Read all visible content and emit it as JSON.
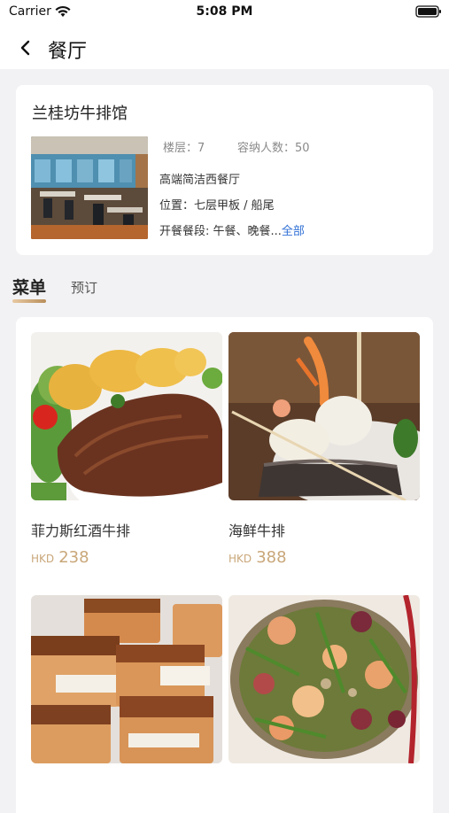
{
  "status_bar": {
    "carrier": "Carrier",
    "time": "5:08 PM"
  },
  "nav": {
    "title": "餐厅"
  },
  "restaurant": {
    "name": "兰桂坊牛排馆",
    "floor_label": "楼层：",
    "floor_value": "7",
    "capacity_label": "容纳人数：",
    "capacity_value": "50",
    "style": "高端简洁西餐厅",
    "location_label": "位置：",
    "location_value": "七层甲板 / 船尾",
    "meal_label": "开餐餐段: ",
    "meal_value": "午餐、晚餐...",
    "show_all": "全部"
  },
  "tabs": {
    "menu": "菜单",
    "booking": "预订"
  },
  "dishes": [
    {
      "name": "菲力斯红酒牛排",
      "currency": "HKD",
      "price": "238"
    },
    {
      "name": "海鲜牛排",
      "currency": "HKD",
      "price": "388"
    },
    {
      "name": "",
      "currency": "",
      "price": ""
    },
    {
      "name": "",
      "currency": "",
      "price": ""
    }
  ],
  "colors": {
    "accent_gold": "#c9a77a",
    "link_blue": "#2f6fd6"
  }
}
